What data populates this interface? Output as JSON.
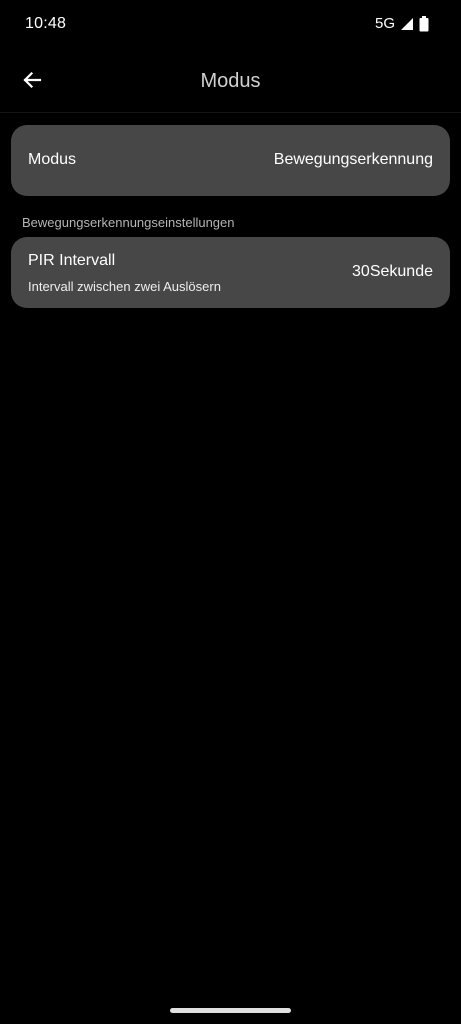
{
  "status_bar": {
    "time": "10:48",
    "network": "5G",
    "icons": [
      "signal-icon",
      "battery-icon"
    ]
  },
  "app_bar": {
    "title": "Modus",
    "back_icon": "arrow-left-icon"
  },
  "mode_row": {
    "label": "Modus",
    "value": "Bewegungserkennung"
  },
  "section": {
    "header": "Bewegungserkennungseinstellungen"
  },
  "pir_row": {
    "label": "PIR Intervall",
    "subtitle": "Intervall zwischen zwei Auslösern",
    "value": "30Sekunde"
  },
  "colors": {
    "background": "#000000",
    "card": "#474747",
    "text": "#ffffff",
    "section_header": "#b5b5b5"
  }
}
